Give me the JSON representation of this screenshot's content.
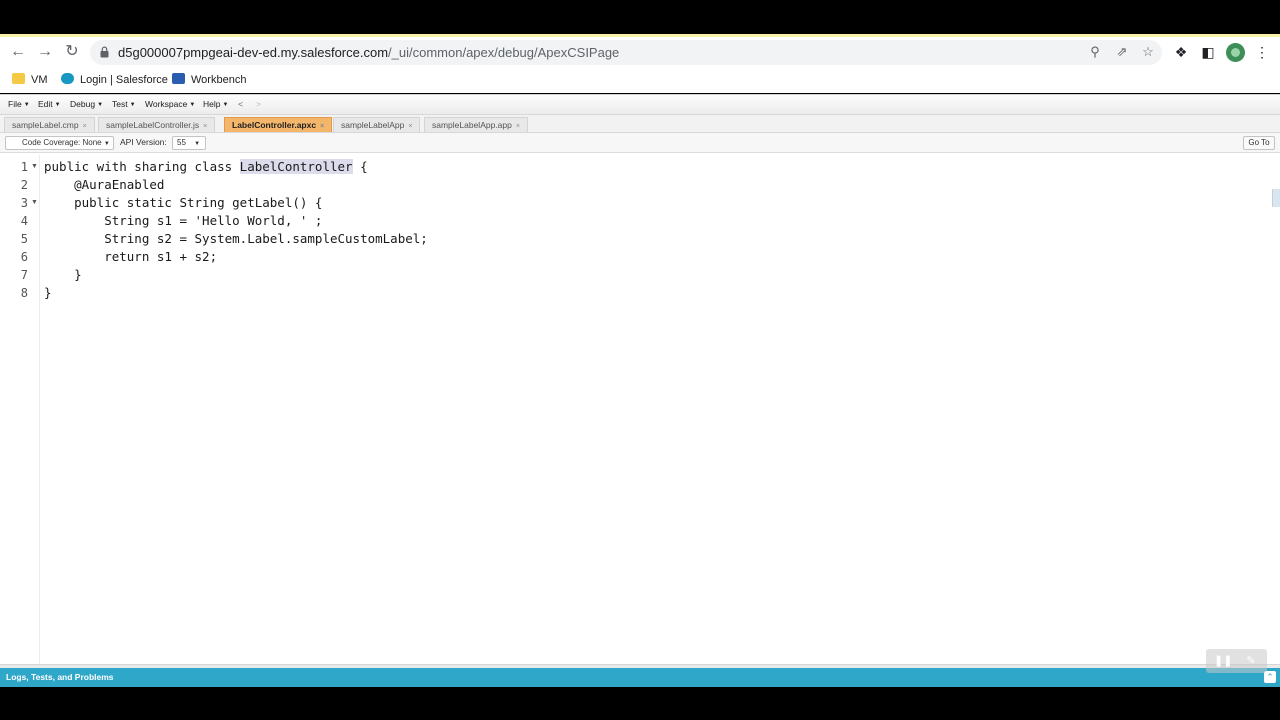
{
  "browser": {
    "url_host": "d5g000007pmpgeai-dev-ed.my.salesforce.com",
    "url_path": "/_ui/common/apex/debug/ApexCSIPage",
    "bookmarks": [
      {
        "label": "VM",
        "icon": "folder-icon",
        "color": "#f6c945"
      },
      {
        "label": "Login | Salesforce",
        "icon": "salesforce-cloud-icon",
        "color": "#1798c1"
      },
      {
        "label": "Workbench",
        "icon": "workbench-cube-icon",
        "color": "#2a5db0"
      }
    ]
  },
  "console": {
    "menus": [
      "File",
      "Edit",
      "Debug",
      "Test",
      "Workspace",
      "Help"
    ],
    "tabs": [
      {
        "label": "sampleLabel.cmp",
        "active": false
      },
      {
        "label": "sampleLabelController.js",
        "active": false
      },
      {
        "label": "LabelController.apxc",
        "active": true
      },
      {
        "label": "sampleLabelApp",
        "active": false
      },
      {
        "label": "sampleLabelApp.app",
        "active": false
      }
    ],
    "toolbar": {
      "coverage": "Code Coverage: None",
      "api_label": "API Version:",
      "api_value": "55",
      "goto": "Go To"
    },
    "code_lines": [
      {
        "n": "1",
        "fold": true
      },
      {
        "n": "2",
        "fold": false
      },
      {
        "n": "3",
        "fold": true
      },
      {
        "n": "4",
        "fold": false
      },
      {
        "n": "5",
        "fold": false
      },
      {
        "n": "6",
        "fold": false
      },
      {
        "n": "7",
        "fold": false
      },
      {
        "n": "8",
        "fold": false
      }
    ],
    "code": {
      "l1a": "public with sharing class ",
      "l1sel": "LabelController",
      "l1b": " {",
      "l2": "    @AuraEnabled",
      "l3": "    public static String getLabel() {",
      "l4": "        String s1 = 'Hello World, ' ;",
      "l5": "        String s2 = System.Label.sampleCustomLabel;",
      "l6": "        return s1 + s2;",
      "l7": "    }",
      "l8": "}"
    },
    "bottom_panel": "Logs, Tests, and Problems"
  }
}
